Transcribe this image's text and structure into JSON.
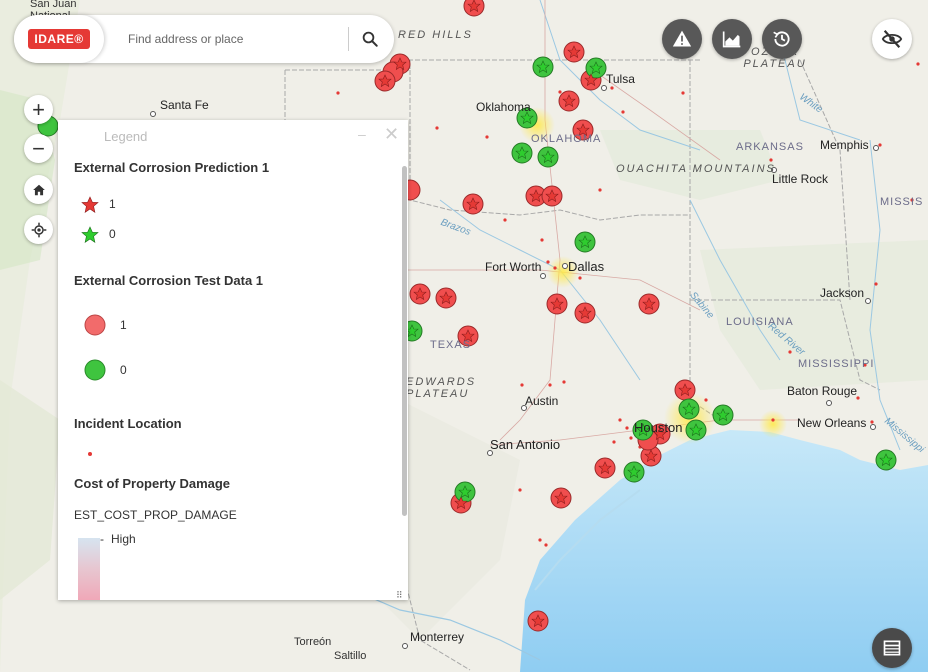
{
  "app": {
    "logo_text": "IDARE®"
  },
  "search": {
    "placeholder": "Find address or place"
  },
  "tools": [
    {
      "name": "alert-button",
      "icon": "warning-icon"
    },
    {
      "name": "chart-button",
      "icon": "area-chart-icon"
    },
    {
      "name": "history-button",
      "icon": "clock-history-icon"
    },
    {
      "name": "visibility-button",
      "icon": "eye-off-icon"
    }
  ],
  "map_controls": {
    "zoom_in": "+",
    "zoom_out": "−"
  },
  "legend": {
    "title": "Legend",
    "section1": {
      "title": "External Corrosion Prediction 1",
      "items": [
        {
          "label": "1",
          "color": "#e53935"
        },
        {
          "label": "0",
          "color": "#2ecc2e"
        }
      ]
    },
    "section2": {
      "title": "External Corrosion Test Data 1",
      "items": [
        {
          "label": "1",
          "color": "#f26b6b"
        },
        {
          "label": "0",
          "color": "#3fc43f"
        }
      ]
    },
    "section3": {
      "title": "Incident Location"
    },
    "section4": {
      "title": "Cost of Property Damage",
      "field": "EST_COST_PROP_DAMAGE",
      "high_label": "High"
    }
  },
  "map_labels": {
    "cities": [
      "Santa Fe",
      "Oklahoma City",
      "Tulsa",
      "Memphis",
      "Little Rock",
      "Dallas",
      "Fort Worth",
      "Austin",
      "San Antonio",
      "Houston",
      "Jackson",
      "Baton Rouge",
      "New Orleans",
      "Monterrey",
      "Torreón",
      "Saltillo",
      "San Juan National"
    ],
    "states": [
      "OKLAHOMA",
      "ARKANSAS",
      "LOUISIANA",
      "MISSISSIPPI",
      "TEXAS",
      "MISSIS"
    ],
    "regions": [
      "RED HILLS",
      "OZARK PLATEAU",
      "OUACHITA MOUNTAINS",
      "EDWARDS PLATEAU"
    ],
    "rivers": [
      "Brazos",
      "Sabine",
      "Red River",
      "White",
      "Mississippi"
    ]
  },
  "colors": {
    "red_marker": "#e53935",
    "green_marker": "#2ecc2e",
    "incident_dot": "#e53935",
    "water": "#9fd4f3"
  }
}
